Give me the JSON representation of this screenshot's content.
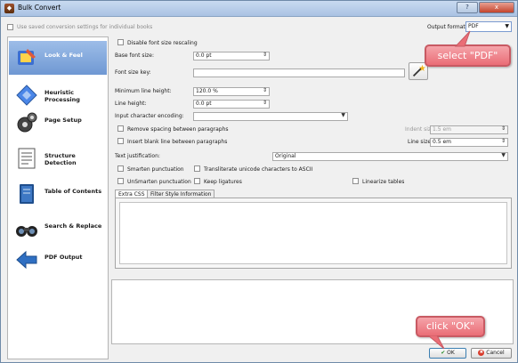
{
  "window": {
    "title": "Bulk Convert",
    "help_button": "?",
    "close_button": "x"
  },
  "top": {
    "use_saved_label": "Use saved conversion settings for individual books",
    "output_format_label": "Output format:",
    "output_format_value": "PDF"
  },
  "sidebar": {
    "items": [
      {
        "label": "Look & Feel",
        "icon": "look-feel-icon",
        "active": true
      },
      {
        "label": "Heuristic Processing",
        "icon": "heuristic-icon",
        "active": false
      },
      {
        "label": "Page Setup",
        "icon": "page-setup-icon",
        "active": false
      },
      {
        "label": "Structure Detection",
        "icon": "structure-icon",
        "active": false
      },
      {
        "label": "Table of Contents",
        "icon": "toc-icon",
        "active": false
      },
      {
        "label": "Search & Replace",
        "icon": "search-replace-icon",
        "active": false
      },
      {
        "label": "PDF Output",
        "icon": "pdf-output-icon",
        "active": false
      }
    ]
  },
  "form": {
    "disable_font_rescaling": "Disable font size rescaling",
    "base_font_size_label": "Base font size:",
    "base_font_size_value": "0.0 pt",
    "font_size_key_label": "Font size key:",
    "min_line_height_label": "Minimum line height:",
    "min_line_height_value": "120.0 %",
    "line_height_label": "Line height:",
    "line_height_value": "0.0 pt",
    "input_encoding_label": "Input character encoding:",
    "remove_spacing_label": "Remove spacing between paragraphs",
    "indent_size_label": "Indent size:",
    "indent_size_value": "1.5 em",
    "insert_blank_label": "Insert blank line between paragraphs",
    "line_size_label": "Line size:",
    "line_size_value": "0.5 em",
    "text_justification_label": "Text justification:",
    "text_justification_value": "Original",
    "smarten_punctuation": "Smarten punctuation",
    "transliterate_unicode": "Transliterate unicode characters to ASCII",
    "unsmarten_punctuation": "UnSmarten punctuation",
    "keep_ligatures": "Keep ligatures",
    "linearize_tables": "Linearize tables"
  },
  "tabs": [
    "Extra CSS",
    "Filter Style Information"
  ],
  "buttons": {
    "ok": "OK",
    "cancel": "Cancel"
  },
  "annotations": {
    "select_pdf": "select \"PDF\"",
    "click_ok": "click \"OK\""
  },
  "colors": {
    "accent": "#6f98d3",
    "callout": "#ea6d76"
  }
}
